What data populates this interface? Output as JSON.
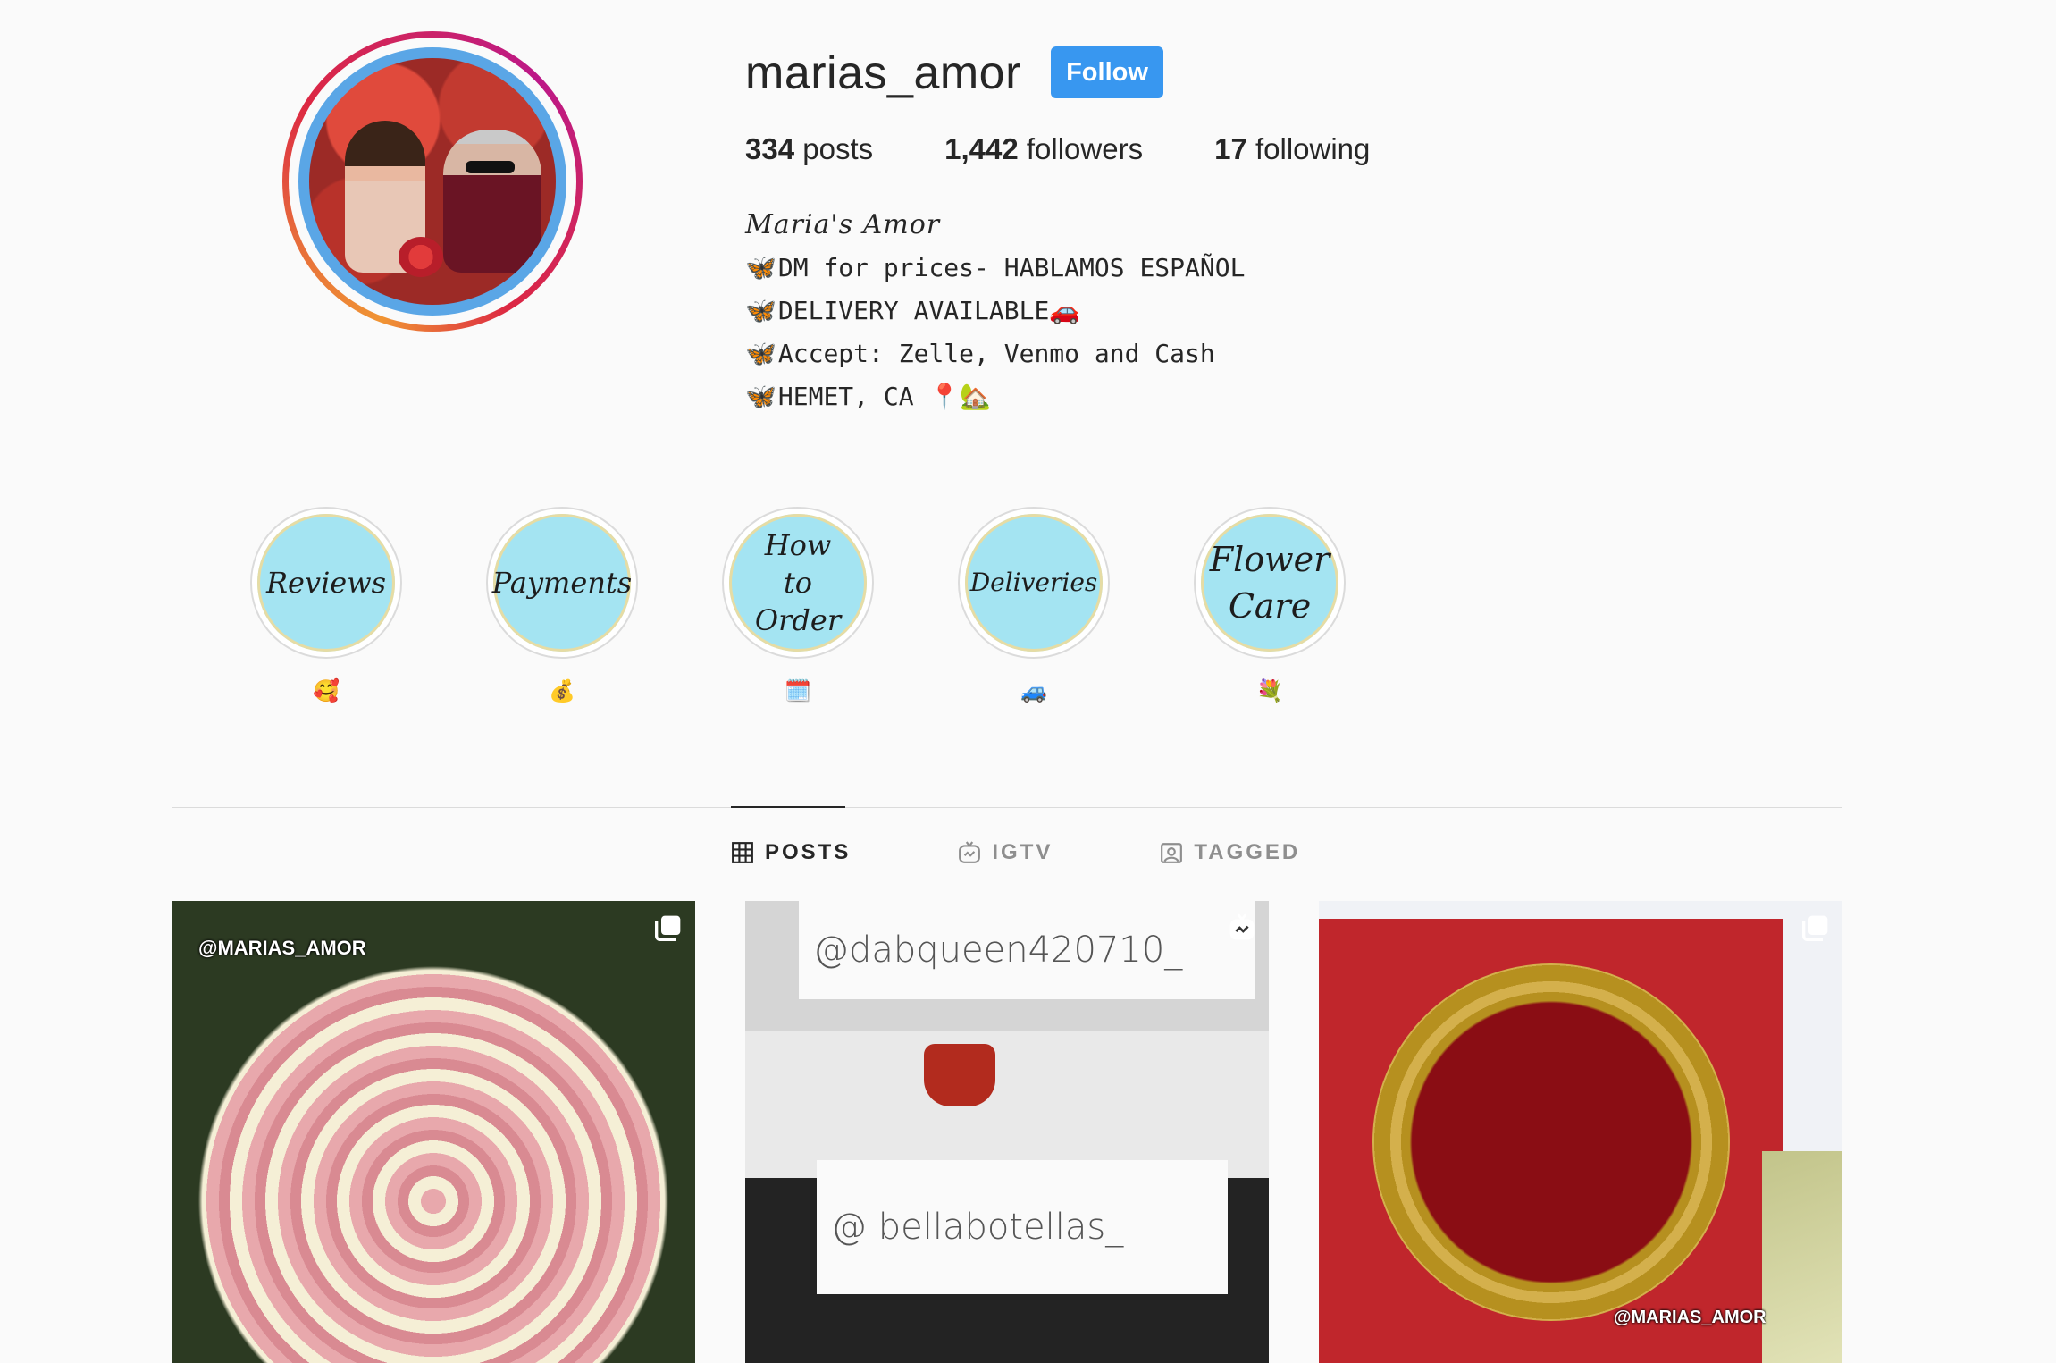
{
  "profile": {
    "username": "marias_amor",
    "follow_label": "Follow",
    "stats": {
      "posts_count": "334",
      "posts_label": "posts",
      "followers_count": "1,442",
      "followers_label": "followers",
      "following_count": "17",
      "following_label": "following"
    },
    "bio": {
      "name": "Maria's Amor",
      "lines": [
        {
          "icon": "butterfly",
          "text": "DM for prices- HABLAMOS ESPAÑOL",
          "suffix": ""
        },
        {
          "icon": "butterfly",
          "text": "DELIVERY AVAILABLE",
          "suffix": "🚗"
        },
        {
          "icon": "butterfly",
          "text": "Accept: Zelle, Venmo and Cash",
          "suffix": ""
        },
        {
          "icon": "butterfly",
          "text": "HEMET, CA ",
          "suffix": "📍🏡"
        }
      ]
    }
  },
  "highlights": [
    {
      "cover_text": "Reviews",
      "label": "🥰"
    },
    {
      "cover_text": "Payments",
      "label": "💰"
    },
    {
      "cover_text": "How to Order",
      "label": "🗓️"
    },
    {
      "cover_text": "Deliveries",
      "label": "🚙"
    },
    {
      "cover_text": "Flower Care",
      "label": "💐"
    }
  ],
  "tabs": [
    {
      "label": "POSTS",
      "icon": "grid-icon",
      "active": true
    },
    {
      "label": "IGTV",
      "icon": "igtv-icon",
      "active": false
    },
    {
      "label": "TAGGED",
      "icon": "tagged-icon",
      "active": false
    }
  ],
  "posts": [
    {
      "watermark": "@MARIAS_AMOR",
      "badge": "carousel-icon"
    },
    {
      "note_top": "@dabqueen420710_",
      "note_bottom": "@ bellabotellas_",
      "badge": "igtv-icon"
    },
    {
      "watermark": "@MARIAS_AMOR",
      "badge": "carousel-icon"
    }
  ],
  "colors": {
    "follow_button": "#3897f0",
    "highlight_cover": "#a4e4f2",
    "background": "#fafafa"
  }
}
